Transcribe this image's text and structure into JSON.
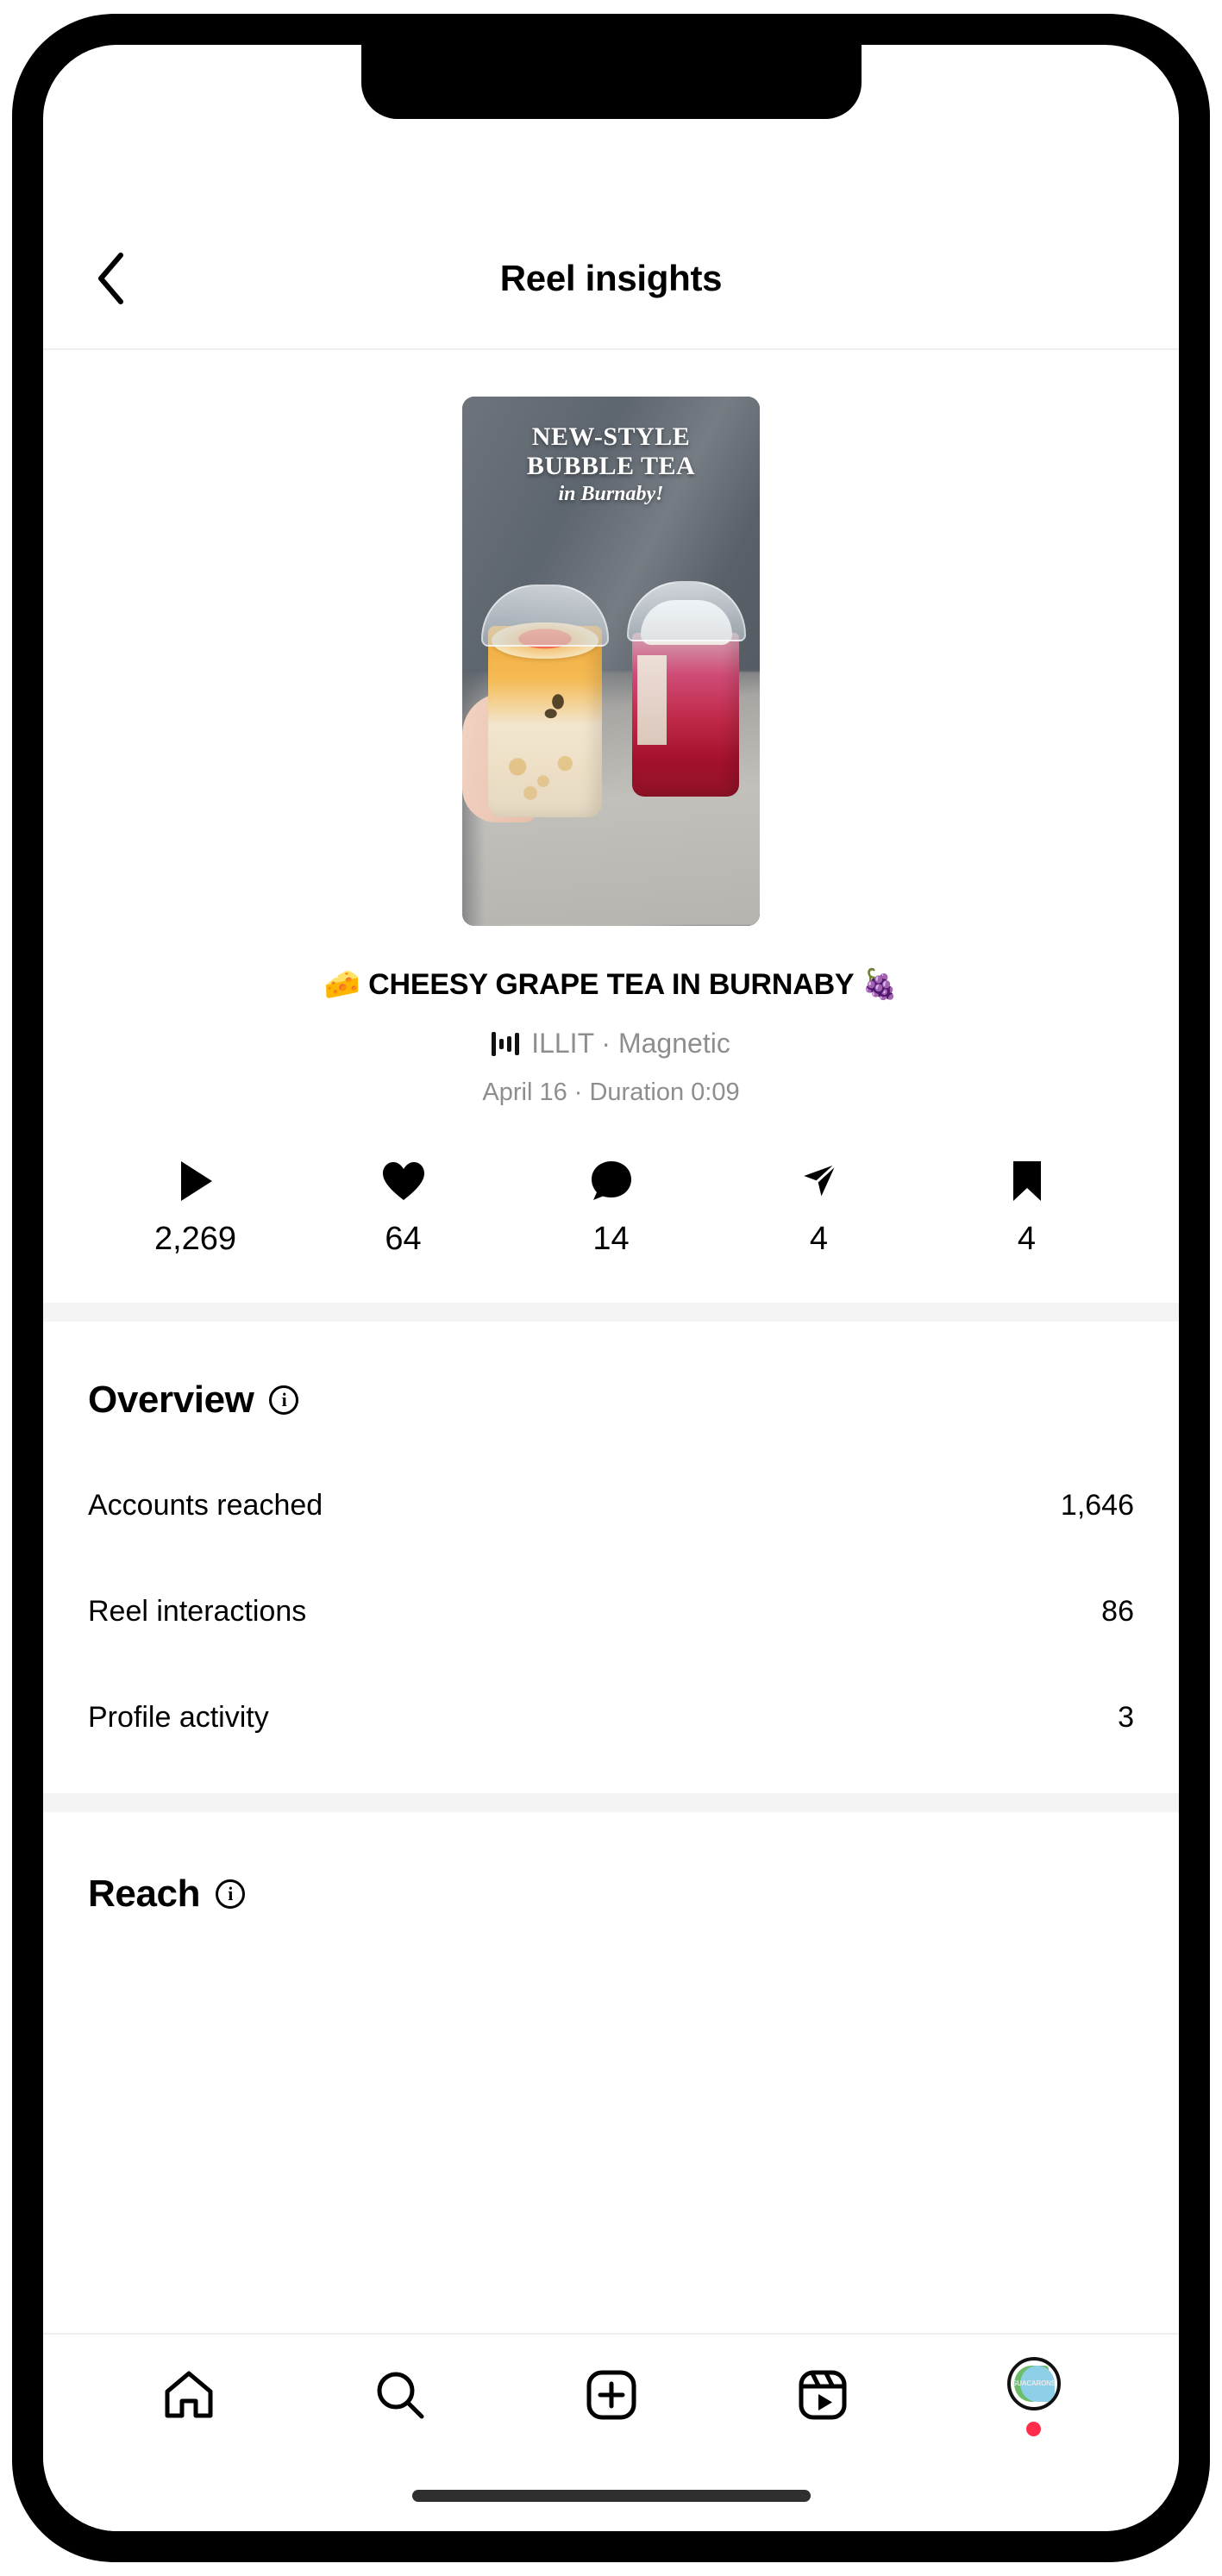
{
  "header": {
    "title": "Reel insights",
    "back_icon": "chevron-left-icon"
  },
  "reel": {
    "thumbnail": {
      "overlay_line1": "NEW-STYLE",
      "overlay_line2": "BUBBLE TEA",
      "overlay_line3": "in Burnaby!"
    },
    "caption": "🧀 CHEESY GRAPE TEA IN BURNABY 🍇",
    "music": "ILLIT · Magnetic",
    "music_icon": "audio-waveform-icon",
    "meta": "April 16 · Duration 0:09"
  },
  "metrics": [
    {
      "name": "plays",
      "icon": "play-icon",
      "value": "2,269"
    },
    {
      "name": "likes",
      "icon": "heart-icon",
      "value": "64"
    },
    {
      "name": "comments",
      "icon": "comment-icon",
      "value": "14"
    },
    {
      "name": "shares",
      "icon": "share-icon",
      "value": "4"
    },
    {
      "name": "saves",
      "icon": "bookmark-icon",
      "value": "4"
    }
  ],
  "overview": {
    "title": "Overview",
    "info_icon": "info-icon",
    "info_glyph": "i",
    "rows": [
      {
        "label": "Accounts reached",
        "value": "1,646"
      },
      {
        "label": "Reel interactions",
        "value": "86"
      },
      {
        "label": "Profile activity",
        "value": "3"
      }
    ]
  },
  "reach": {
    "title": "Reach",
    "info_icon": "info-icon",
    "info_glyph": "i"
  },
  "bottom_nav": [
    {
      "name": "home",
      "icon": "home-icon"
    },
    {
      "name": "search",
      "icon": "search-icon"
    },
    {
      "name": "create",
      "icon": "plus-square-icon"
    },
    {
      "name": "reels",
      "icon": "reels-icon"
    },
    {
      "name": "profile",
      "icon": "avatar-icon",
      "brand": "GUACARONS",
      "has_notification": true
    }
  ],
  "colors": {
    "accent_notification": "#ff2d4b",
    "divider": "#f4f4f4",
    "muted_text": "#8e8e8e",
    "avatar_green": "#6cbd6a",
    "avatar_blue": "#8ecfe8"
  }
}
